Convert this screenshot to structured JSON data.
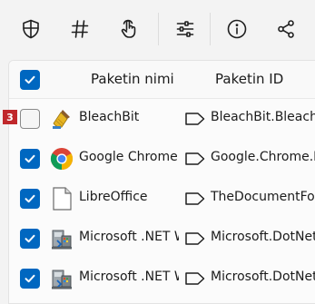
{
  "toolbar": {
    "buttons": [
      {
        "icon": "shield-icon"
      },
      {
        "icon": "hash-icon"
      },
      {
        "icon": "hand-pointer-icon"
      },
      {
        "icon": "sliders-icon"
      },
      {
        "icon": "info-icon"
      },
      {
        "icon": "share-icon"
      }
    ]
  },
  "table": {
    "headers": {
      "name": "Paketin nimi",
      "id": "Paketin ID"
    },
    "select_all_checked": true,
    "rows": [
      {
        "checked": false,
        "icon": "bleachbit-icon",
        "name": "BleachBit",
        "id": "BleachBit.BleachBit"
      },
      {
        "checked": true,
        "icon": "google-chrome-icon",
        "name": "Google Chrome (EXE)",
        "id": "Google.Chrome.EXE"
      },
      {
        "checked": true,
        "icon": "libreoffice-icon",
        "name": "LibreOffice",
        "id": "TheDocumentFoundation.LibreOffice"
      },
      {
        "checked": true,
        "icon": "installer-icon",
        "name": "Microsoft .NET Windows Desktop Runtime",
        "id": "Microsoft.DotNet.DesktopRuntime"
      },
      {
        "checked": true,
        "icon": "installer-icon",
        "name": "Microsoft .NET Windows Desktop Runtime",
        "id": "Microsoft.DotNet.DesktopRuntime"
      }
    ]
  },
  "badge": {
    "label": "3",
    "color": "#c0282b"
  },
  "colors": {
    "accent": "#0067c0",
    "background": "#f3f3f3"
  }
}
